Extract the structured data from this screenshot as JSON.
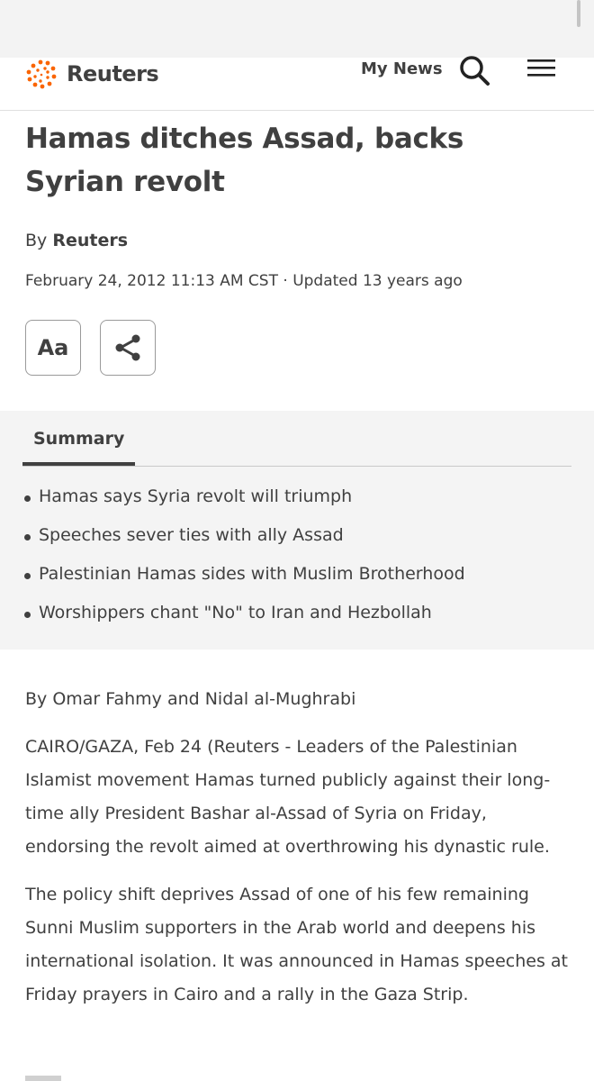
{
  "brand": {
    "name": "Reuters",
    "accent_color": "#fa6400",
    "text_color": "#404040"
  },
  "nav": {
    "my_news_label": "My News",
    "search_icon": "search-icon",
    "menu_icon": "hamburger-menu-icon"
  },
  "article": {
    "headline": "Hamas ditches Assad, backs Syrian revolt",
    "byline_prefix": "By",
    "byline_author": "Reuters",
    "dateline": "February 24, 2012 11:13 AM CST · Updated 13 years ago",
    "font_button_label": "Aa",
    "share_icon": "share-icon"
  },
  "summary": {
    "tab_label": "Summary",
    "items": [
      "Hamas says Syria revolt will triumph",
      "Speeches sever ties with ally Assad",
      "Palestinian Hamas sides with Muslim Brotherhood",
      "Worshippers chant \"No\" to Iran and Hezbollah"
    ]
  },
  "body": {
    "author_line": "By Omar Fahmy and Nidal al-Mughrabi",
    "paragraphs": [
      "CAIRO/GAZA, Feb 24 (Reuters - Leaders of the Palestinian Islamist movement Hamas turned publicly against their long-time ally President Bashar al-Assad of Syria on Friday, endorsing the revolt aimed at overthrowing his dynastic rule.",
      "The policy shift deprives Assad of one of his few remaining Sunni Muslim supporters in the Arab world and deepens his international isolation. It was announced in Hamas speeches at Friday prayers in Cairo and a rally in the Gaza Strip."
    ]
  }
}
